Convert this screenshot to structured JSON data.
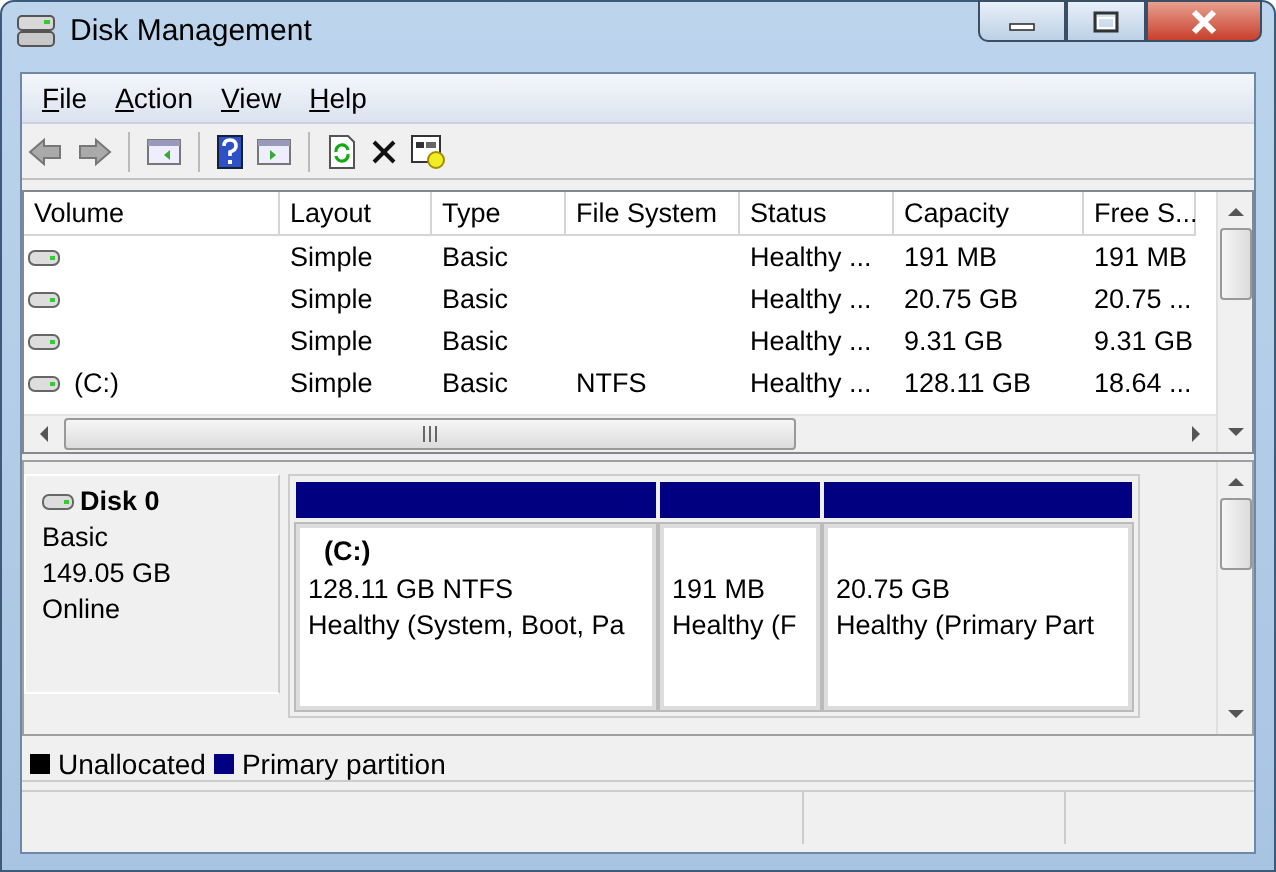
{
  "window": {
    "title": "Disk Management"
  },
  "menu": [
    {
      "label": "File"
    },
    {
      "label": "Action"
    },
    {
      "label": "View"
    },
    {
      "label": "Help"
    }
  ],
  "volume_list": {
    "columns": [
      "Volume",
      "Layout",
      "Type",
      "File System",
      "Status",
      "Capacity",
      "Free S..."
    ],
    "rows": [
      {
        "volume": "",
        "layout": "Simple",
        "type": "Basic",
        "file_system": "",
        "status": "Healthy ...",
        "capacity": "191 MB",
        "free_space": "191 MB"
      },
      {
        "volume": "",
        "layout": "Simple",
        "type": "Basic",
        "file_system": "",
        "status": "Healthy ...",
        "capacity": "20.75 GB",
        "free_space": "20.75 ..."
      },
      {
        "volume": "",
        "layout": "Simple",
        "type": "Basic",
        "file_system": "",
        "status": "Healthy ...",
        "capacity": "9.31 GB",
        "free_space": "9.31 GB"
      },
      {
        "volume": "(C:)",
        "layout": "Simple",
        "type": "Basic",
        "file_system": "NTFS",
        "status": "Healthy ...",
        "capacity": "128.11 GB",
        "free_space": "18.64 ..."
      }
    ]
  },
  "disk": {
    "name": "Disk 0",
    "type": "Basic",
    "size": "149.05 GB",
    "status": "Online",
    "partitions": [
      {
        "name": "(C:)",
        "size": "128.11 GB NTFS",
        "status": "Healthy (System, Boot, Pa",
        "color": "#000080"
      },
      {
        "size": "191 MB",
        "status": "Healthy (F",
        "color": "#000080"
      },
      {
        "size": "20.75 GB",
        "status": "Healthy (Primary Part",
        "color": "#000080"
      }
    ]
  },
  "legend": [
    {
      "label": "Unallocated",
      "color": "#000000"
    },
    {
      "label": "Primary partition",
      "color": "#000080"
    }
  ]
}
